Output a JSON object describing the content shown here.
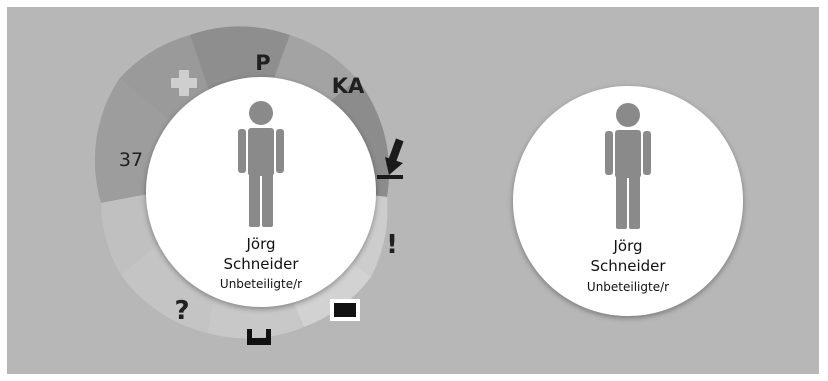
{
  "colors": {
    "background": "#b7b7b7",
    "segment_dark": "#8e8e8e",
    "segment_light": "#c9c9c9",
    "person_icon": "#8a8a8a",
    "card": "#ffffff"
  },
  "radial_menu": {
    "segments": [
      {
        "id": "plus",
        "icon": "plus-icon",
        "label": ""
      },
      {
        "id": "p",
        "icon": "",
        "label": "P"
      },
      {
        "id": "ka",
        "icon": "",
        "label": "KA"
      },
      {
        "id": "arrow",
        "icon": "arrow-down-icon",
        "label": ""
      },
      {
        "id": "alert",
        "icon": "",
        "label": "!"
      },
      {
        "id": "square",
        "icon": "black-square-icon",
        "label": ""
      },
      {
        "id": "tray",
        "icon": "tray-icon",
        "label": ""
      },
      {
        "id": "question",
        "icon": "",
        "label": "?"
      },
      {
        "id": "number",
        "icon": "",
        "label": "37"
      }
    ]
  },
  "person_left": {
    "first_name": "Jörg",
    "last_name": "Schneider",
    "role": "Unbeteiligte/r"
  },
  "person_right": {
    "first_name": "Jörg",
    "last_name": "Schneider",
    "role": "Unbeteiligte/r"
  }
}
